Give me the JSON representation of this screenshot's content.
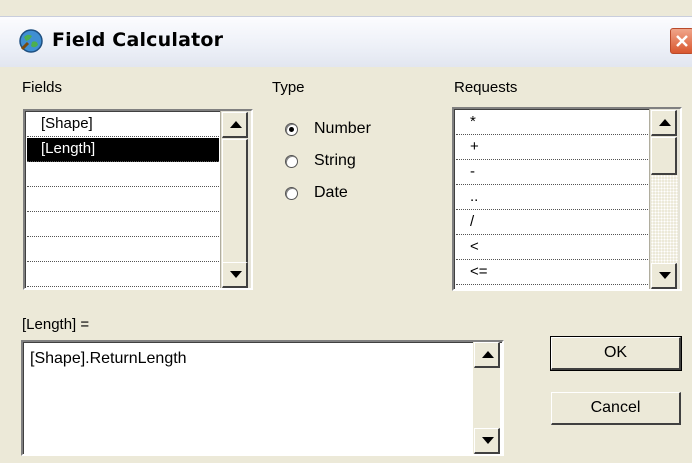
{
  "window": {
    "title": "Field Calculator"
  },
  "fields": {
    "label": "Fields",
    "items": [
      "[Shape]",
      "[Length]",
      "",
      "",
      "",
      "",
      ""
    ],
    "selected_index": 1
  },
  "type": {
    "label": "Type",
    "options": [
      {
        "label": "Number",
        "selected": true
      },
      {
        "label": "String",
        "selected": false
      },
      {
        "label": "Date",
        "selected": false
      }
    ]
  },
  "requests": {
    "label": "Requests",
    "items": [
      "*",
      "+",
      "-",
      "..",
      "/",
      "<",
      "<="
    ]
  },
  "expression": {
    "label": "[Length] =",
    "value": "[Shape].ReturnLength"
  },
  "buttons": {
    "ok": "OK",
    "cancel": "Cancel"
  },
  "icons": {
    "app": "calculator-globe-icon",
    "close": "close-icon"
  },
  "colors": {
    "close_red": "#d9572f",
    "selection": "#000000",
    "dialog_bg": "#ece9d8"
  }
}
